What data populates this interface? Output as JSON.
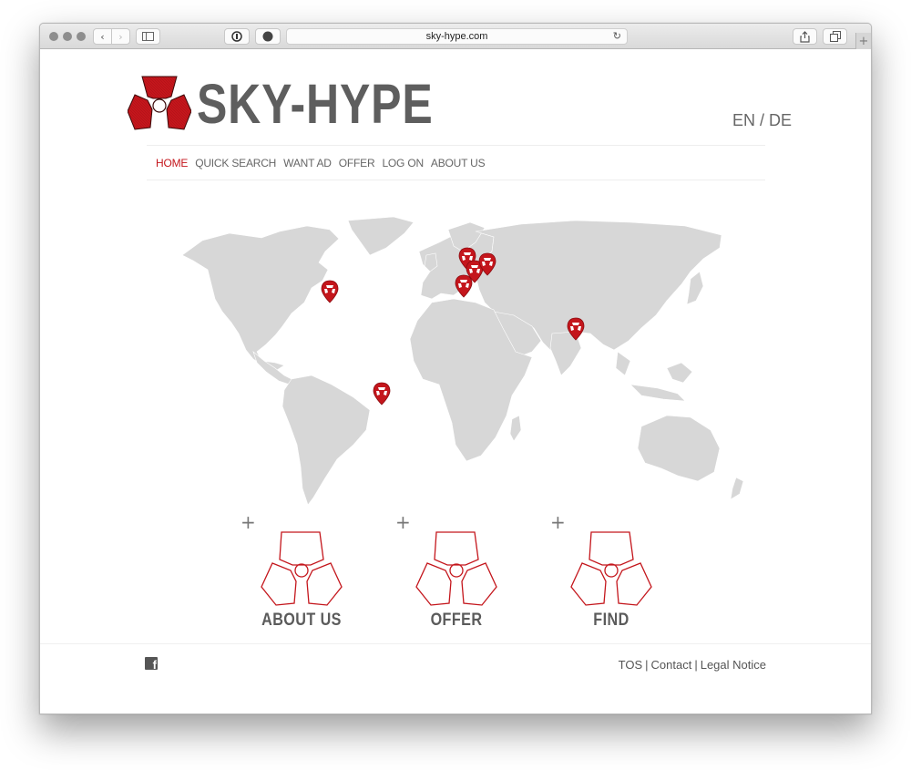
{
  "browser": {
    "url": "sky-hype.com"
  },
  "site": {
    "brand": "SKY-HYPE",
    "language": "EN / DE"
  },
  "nav": {
    "items": [
      "HOME",
      "QUICK SEARCH",
      "WANT AD",
      "OFFER",
      "LOG ON",
      "ABOUT US"
    ],
    "active": "HOME"
  },
  "map": {
    "markers": [
      "north-america-east",
      "western-europe-north",
      "western-europe-center",
      "central-europe",
      "southwest-europe",
      "middle-east",
      "south-america"
    ]
  },
  "features": [
    {
      "plus": "+",
      "label": "ABOUT US"
    },
    {
      "plus": "+",
      "label": "OFFER"
    },
    {
      "plus": "+",
      "label": "FIND"
    }
  ],
  "footer": {
    "links": [
      "TOS",
      "Contact",
      "Legal Notice"
    ],
    "separator": "|"
  },
  "colors": {
    "brand_red": "#c4161c",
    "text_grey": "#5e5e5e",
    "map_grey": "#d6d6d6"
  }
}
